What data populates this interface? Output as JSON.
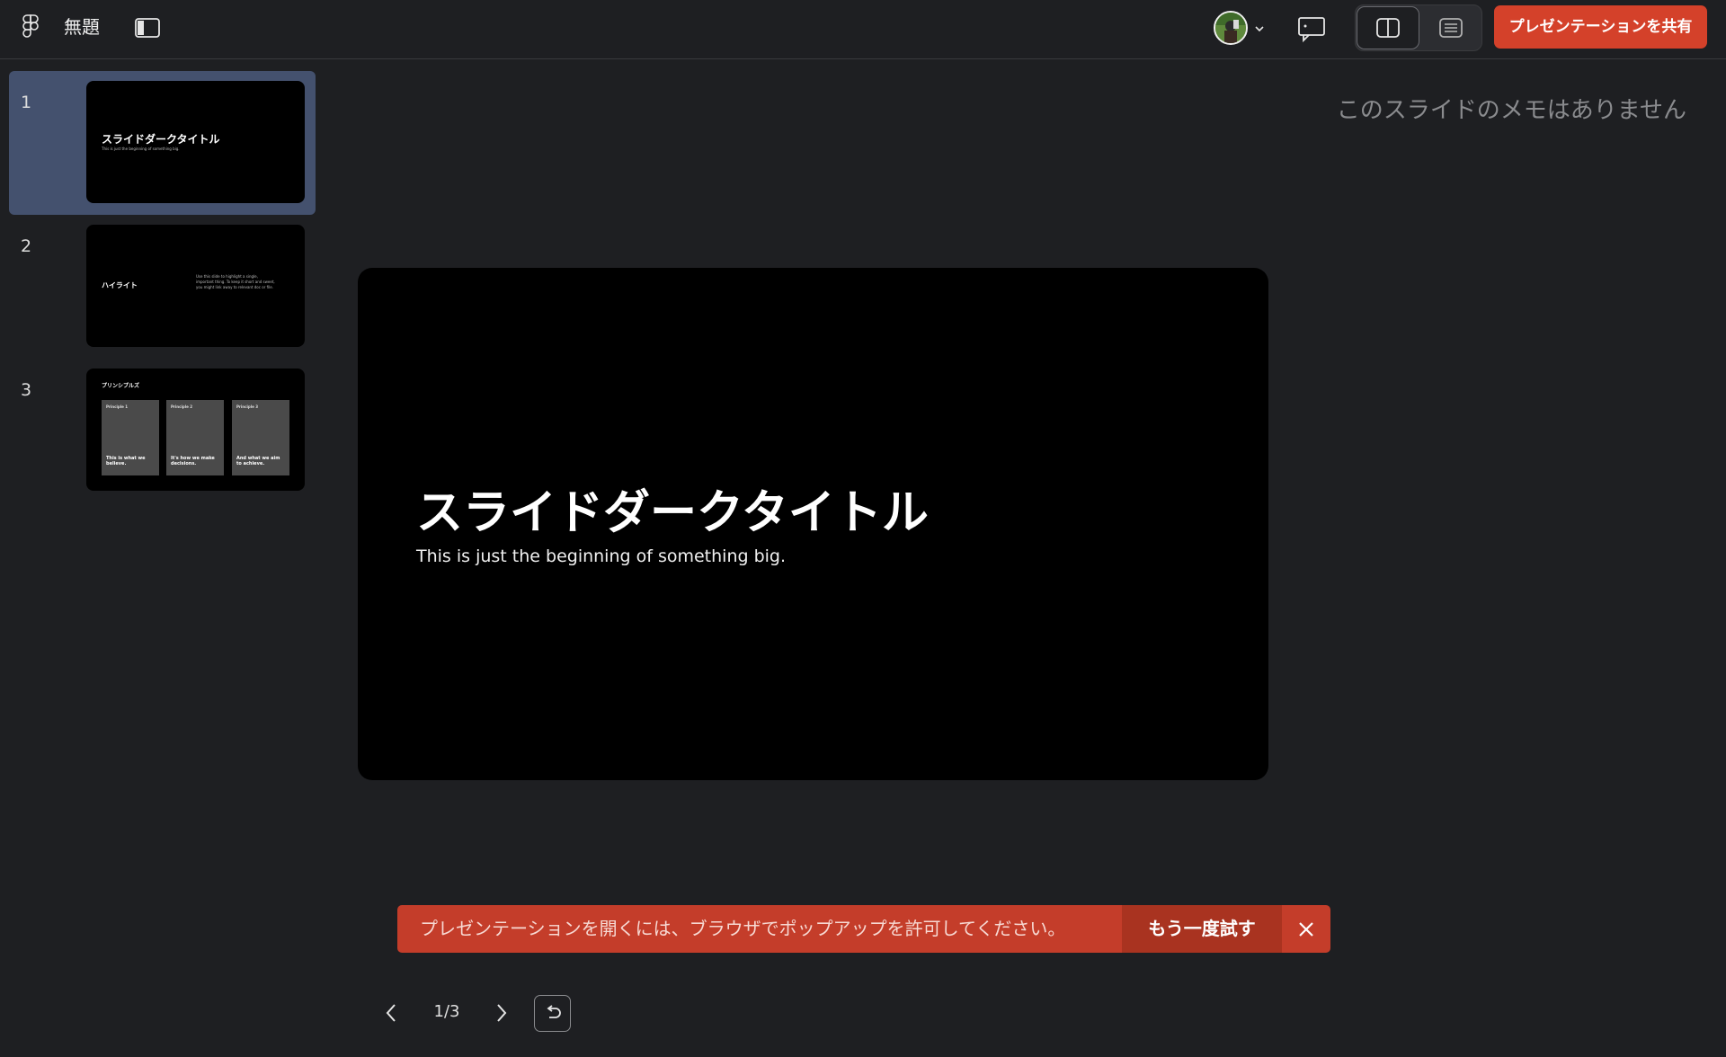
{
  "app": {
    "title": "無題"
  },
  "header": {
    "share_label": "プレゼンテーションを共有",
    "icons": [
      "figma-logo-icon",
      "sidebar-toggle-icon",
      "avatar",
      "chevron-down-icon",
      "comment-icon",
      "split-view-icon",
      "notes-view-icon"
    ]
  },
  "slides_panel": {
    "items": [
      {
        "number": "1",
        "title": "スライドダークタイトル",
        "subtitle": "This is just the beginning of something big.",
        "selected": true
      },
      {
        "number": "2",
        "title": "ハイライト",
        "body": "Use this slide to highlight a single, important thing. To keep it short and sweet, you might link away to relevant doc or file.",
        "selected": false
      },
      {
        "number": "3",
        "title": "プリンシプルズ",
        "selected": false,
        "cards": [
          {
            "heading": "Principle 1",
            "body": "This is what we believe."
          },
          {
            "heading": "Principle 2",
            "body": "It's how we make decisions."
          },
          {
            "heading": "Principle 3",
            "body": "And what we aim to achieve."
          }
        ]
      }
    ]
  },
  "notes": {
    "empty_text": "このスライドのメモはありません"
  },
  "slide": {
    "title": "スライドダークタイトル",
    "subtitle": "This is just the beginning of something big."
  },
  "toast": {
    "message": "プレゼンテーションを開くには、ブラウザでポップアップを許可してください。",
    "retry_label": "もう一度試す",
    "color": "#c43d2a"
  },
  "navigation": {
    "counter": "1/3"
  },
  "colors": {
    "accent": "#d4412a",
    "selected": "#44516e",
    "background": "#1e1f22"
  }
}
